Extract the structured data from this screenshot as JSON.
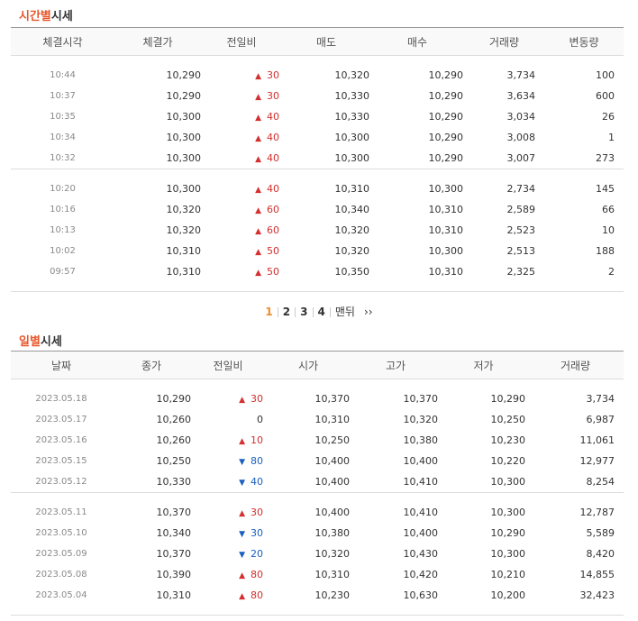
{
  "time_section": {
    "title_highlight": "시간별",
    "title_rest": "시세",
    "headers": [
      "체결시각",
      "체결가",
      "전일비",
      "매도",
      "매수",
      "거래량",
      "변동량"
    ],
    "groups": [
      [
        {
          "time": "10:44",
          "price": "10,290",
          "dir": "up",
          "change": "30",
          "ask": "10,320",
          "bid": "10,290",
          "volume": "3,734",
          "delta": "100"
        },
        {
          "time": "10:37",
          "price": "10,290",
          "dir": "up",
          "change": "30",
          "ask": "10,330",
          "bid": "10,290",
          "volume": "3,634",
          "delta": "600"
        },
        {
          "time": "10:35",
          "price": "10,300",
          "dir": "up",
          "change": "40",
          "ask": "10,330",
          "bid": "10,290",
          "volume": "3,034",
          "delta": "26"
        },
        {
          "time": "10:34",
          "price": "10,300",
          "dir": "up",
          "change": "40",
          "ask": "10,300",
          "bid": "10,290",
          "volume": "3,008",
          "delta": "1"
        },
        {
          "time": "10:32",
          "price": "10,300",
          "dir": "up",
          "change": "40",
          "ask": "10,300",
          "bid": "10,290",
          "volume": "3,007",
          "delta": "273"
        }
      ],
      [
        {
          "time": "10:20",
          "price": "10,300",
          "dir": "up",
          "change": "40",
          "ask": "10,310",
          "bid": "10,300",
          "volume": "2,734",
          "delta": "145"
        },
        {
          "time": "10:16",
          "price": "10,320",
          "dir": "up",
          "change": "60",
          "ask": "10,340",
          "bid": "10,310",
          "volume": "2,589",
          "delta": "66"
        },
        {
          "time": "10:13",
          "price": "10,320",
          "dir": "up",
          "change": "60",
          "ask": "10,320",
          "bid": "10,310",
          "volume": "2,523",
          "delta": "10"
        },
        {
          "time": "10:02",
          "price": "10,310",
          "dir": "up",
          "change": "50",
          "ask": "10,320",
          "bid": "10,300",
          "volume": "2,513",
          "delta": "188"
        },
        {
          "time": "09:57",
          "price": "10,310",
          "dir": "up",
          "change": "50",
          "ask": "10,350",
          "bid": "10,310",
          "volume": "2,325",
          "delta": "2"
        }
      ]
    ],
    "pagination": {
      "pages": [
        "1",
        "2",
        "3",
        "4"
      ],
      "current": "1",
      "last_label": "맨뒤",
      "next_label": "››"
    }
  },
  "daily_section": {
    "title_highlight": "일별",
    "title_rest": "시세",
    "headers": [
      "날짜",
      "종가",
      "전일비",
      "시가",
      "고가",
      "저가",
      "거래량"
    ],
    "groups": [
      [
        {
          "date": "2023.05.18",
          "close": "10,290",
          "dir": "up",
          "change": "30",
          "open": "10,370",
          "high": "10,370",
          "low": "10,290",
          "volume": "3,734"
        },
        {
          "date": "2023.05.17",
          "close": "10,260",
          "dir": "none",
          "change": "0",
          "open": "10,310",
          "high": "10,320",
          "low": "10,250",
          "volume": "6,987"
        },
        {
          "date": "2023.05.16",
          "close": "10,260",
          "dir": "up",
          "change": "10",
          "open": "10,250",
          "high": "10,380",
          "low": "10,230",
          "volume": "11,061"
        },
        {
          "date": "2023.05.15",
          "close": "10,250",
          "dir": "down",
          "change": "80",
          "open": "10,400",
          "high": "10,400",
          "low": "10,220",
          "volume": "12,977"
        },
        {
          "date": "2023.05.12",
          "close": "10,330",
          "dir": "down",
          "change": "40",
          "open": "10,400",
          "high": "10,410",
          "low": "10,300",
          "volume": "8,254"
        }
      ],
      [
        {
          "date": "2023.05.11",
          "close": "10,370",
          "dir": "up",
          "change": "30",
          "open": "10,400",
          "high": "10,410",
          "low": "10,300",
          "volume": "12,787"
        },
        {
          "date": "2023.05.10",
          "close": "10,340",
          "dir": "down",
          "change": "30",
          "open": "10,380",
          "high": "10,400",
          "low": "10,290",
          "volume": "5,589"
        },
        {
          "date": "2023.05.09",
          "close": "10,370",
          "dir": "down",
          "change": "20",
          "open": "10,320",
          "high": "10,430",
          "low": "10,300",
          "volume": "8,420"
        },
        {
          "date": "2023.05.08",
          "close": "10,390",
          "dir": "up",
          "change": "80",
          "open": "10,310",
          "high": "10,420",
          "low": "10,210",
          "volume": "14,855"
        },
        {
          "date": "2023.05.04",
          "close": "10,310",
          "dir": "up",
          "change": "80",
          "open": "10,230",
          "high": "10,630",
          "low": "10,200",
          "volume": "32,423"
        }
      ]
    ]
  },
  "colors": {
    "up": "#d32f2f",
    "down": "#1a5fbf",
    "accent": "#e8562a",
    "page_current": "#f08c2a"
  },
  "icons": {
    "up": "triangle-up-icon",
    "down": "triangle-down-icon",
    "next": "double-chevron-right-icon"
  }
}
